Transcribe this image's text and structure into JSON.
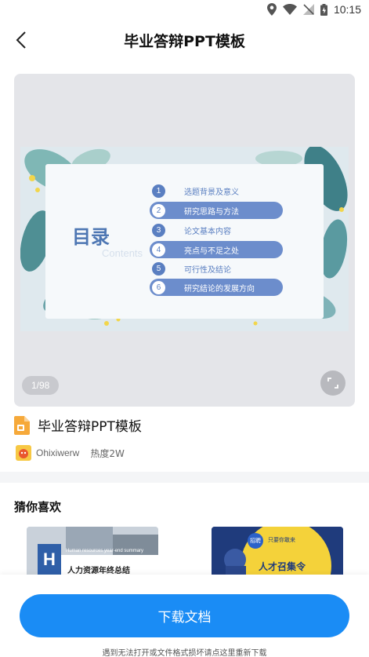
{
  "status_bar": {
    "time": "10:15"
  },
  "header": {
    "title": "毕业答辩PPT模板"
  },
  "preview": {
    "slide": {
      "heading": "目录",
      "subheading": "Contents",
      "toc": [
        {
          "num": "1",
          "text": "选题背景及意义",
          "highlighted": false
        },
        {
          "num": "2",
          "text": "研究思路与方法",
          "highlighted": true
        },
        {
          "num": "3",
          "text": "论文基本内容",
          "highlighted": false
        },
        {
          "num": "4",
          "text": "亮点与不足之处",
          "highlighted": true
        },
        {
          "num": "5",
          "text": "可行性及结论",
          "highlighted": false
        },
        {
          "num": "6",
          "text": "研究结论的发展方向",
          "highlighted": true
        }
      ]
    },
    "page_counter": "1/98"
  },
  "document": {
    "title": "毕业答辩PPT模板",
    "author": "Ohixiwerw",
    "heat": "热度2W"
  },
  "recommendations": {
    "section_title": "猜你喜欢",
    "items": [
      {
        "badge": "H",
        "title": "人力资源年终总结",
        "caption": "Human resources year-end summary"
      },
      {
        "badge": "招聘",
        "title": "人才召集令",
        "caption": "只要你敢来"
      }
    ]
  },
  "bottom": {
    "download_label": "下载文档",
    "help_text": "遇到无法打开或文件格式损坏请点这里重新下载"
  },
  "colors": {
    "accent": "#1a8cf5",
    "slide_blue": "#5a7fc1"
  }
}
